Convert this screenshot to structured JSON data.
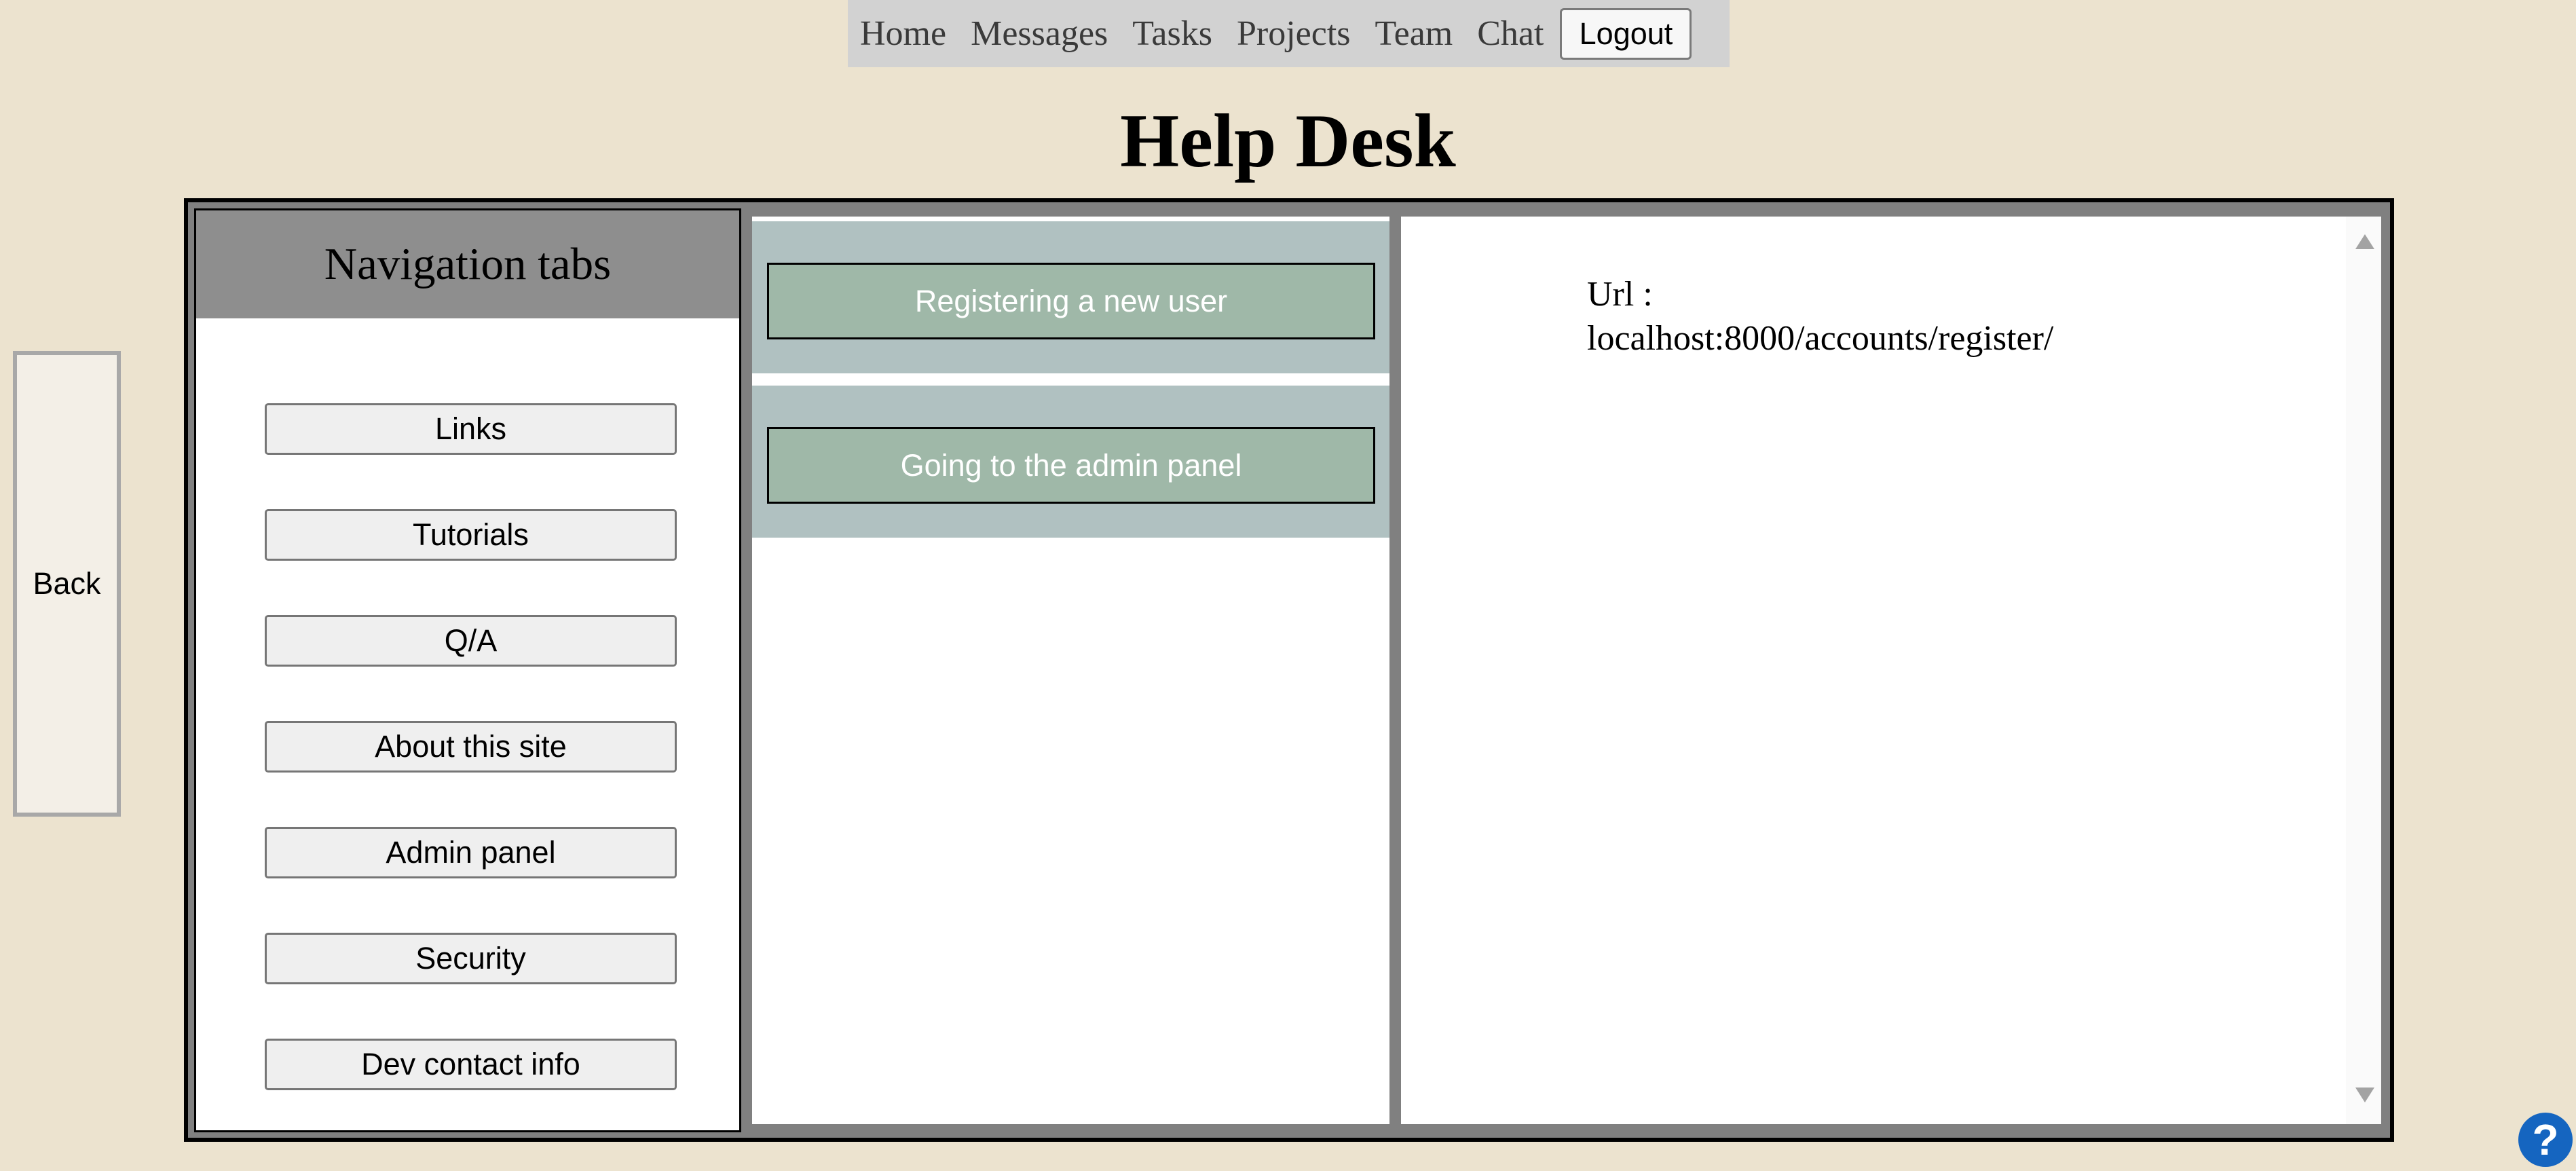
{
  "topnav": {
    "items": [
      "Home",
      "Messages",
      "Tasks",
      "Projects",
      "Team",
      "Chat"
    ],
    "logout_label": "Logout"
  },
  "page_title": "Help Desk",
  "back_label": "Back",
  "nav_panel": {
    "header": "Navigation tabs",
    "buttons": [
      "Links",
      "Tutorials",
      "Q/A",
      "About this site",
      "Admin panel",
      "Security",
      "Dev contact info"
    ]
  },
  "topics": [
    "Registering a new user",
    "Going to the admin panel"
  ],
  "content": {
    "url_label": "Url :",
    "url_value": "localhost:8000/accounts/register/"
  },
  "help_icon": "?"
}
